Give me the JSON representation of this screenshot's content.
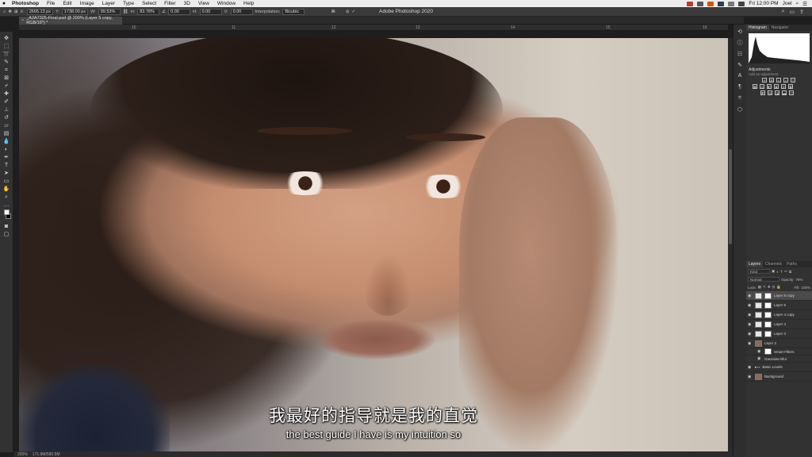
{
  "menubar": {
    "apple": "",
    "items": [
      "Photoshop",
      "File",
      "Edit",
      "Image",
      "Layer",
      "Type",
      "Select",
      "Filter",
      "3D",
      "View",
      "Window",
      "Help"
    ],
    "clock": "Fri 12:00 PM",
    "user": "Joel"
  },
  "window": {
    "title": "Adobe Photoshop 2020"
  },
  "options_bar": {
    "x_label": "X:",
    "x_value": "2665.13 px",
    "y_label": "Y:",
    "y_value": "1738.00 px",
    "w_label": "W:",
    "w_value": "99.53%",
    "h_label": "H:",
    "h_value": "83.78%",
    "angle_value": "0.00",
    "hskew_label": "H:",
    "hskew_value": "0.00",
    "vskew_label": "V:",
    "vskew_value": "0.00",
    "interpolation_label": "Interpolation:",
    "interpolation_value": "Bicubic"
  },
  "document": {
    "tab_title": "_A2A7325-Final.psd @ 200% (Layer 5 copy, RGB/16*) *"
  },
  "ruler": {
    "ticks": [
      "10",
      "11",
      "12",
      "13",
      "14",
      "15",
      "16"
    ]
  },
  "status": {
    "zoom": "200%",
    "info": "171.9M/590.5M"
  },
  "panels": {
    "tabs_top": [
      "Histogram",
      "Navigator"
    ],
    "adjustments_title": "Adjustments",
    "adjustments_sub": "Add an adjustment",
    "layer_tabs": [
      "Layers",
      "Channels",
      "Paths"
    ],
    "kind_label": "Kind",
    "blend_mode": "Normal",
    "opacity_label": "Opacity:",
    "opacity_value": "76%",
    "lock_label": "Lock:",
    "fill_label": "Fill:",
    "fill_value": "100%",
    "layers": [
      {
        "name": "Layer 5 copy",
        "selected": true
      },
      {
        "name": "Layer 5"
      },
      {
        "name": "Layer 4 copy"
      },
      {
        "name": "Layer 4"
      },
      {
        "name": "Layer 3"
      },
      {
        "name": "Layer 2"
      },
      {
        "name": "Smart Filters"
      },
      {
        "name": "Gaussian Blur"
      },
      {
        "name": "Basic Levels"
      },
      {
        "name": "Background"
      }
    ]
  },
  "subtitles": {
    "chinese": "我最好的指导就是我的直觉",
    "english": "the best guide I have is my intuition so"
  }
}
